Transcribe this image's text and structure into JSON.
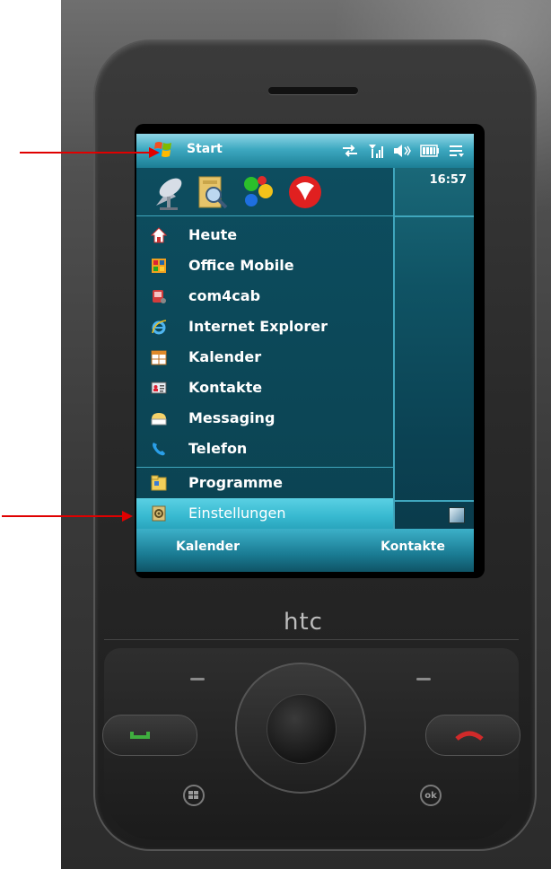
{
  "titlebar": {
    "title": "Start"
  },
  "status": {
    "time": "16:57"
  },
  "start_menu": {
    "items": [
      {
        "label": "Heute",
        "icon": "home-icon"
      },
      {
        "label": "Office Mobile",
        "icon": "office-icon"
      },
      {
        "label": "com4cab",
        "icon": "com4cab-icon"
      },
      {
        "label": "Internet Explorer",
        "icon": "internet-explorer-icon"
      },
      {
        "label": "Kalender",
        "icon": "calendar-icon"
      },
      {
        "label": "Kontakte",
        "icon": "contacts-icon"
      },
      {
        "label": "Messaging",
        "icon": "messaging-icon"
      },
      {
        "label": "Telefon",
        "icon": "phone-icon"
      }
    ],
    "programs_label": "Programme",
    "settings_label": "Einstellungen"
  },
  "softkeys": {
    "left": "Kalender",
    "right": "Kontakte"
  },
  "device": {
    "brand": "htc",
    "ok_label": "ok"
  },
  "colors": {
    "screen_bg": "#0f5364",
    "title_bar": "#3ea9c1",
    "selected_item": "#37b9d0",
    "annotation_arrow": "#e00000"
  }
}
